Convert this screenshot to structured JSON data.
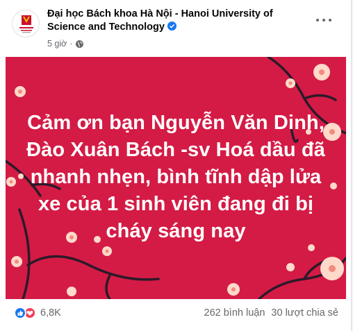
{
  "post": {
    "page_name": "Đại học Bách khoa Hà Nội - Hanoi University of Science and Technology",
    "timestamp": "5 giờ",
    "audience_icon": "globe-icon",
    "verified_icon": "verified-badge-icon",
    "menu_icon": "more-horizontal-icon",
    "image_text": "Cảm ơn bạn Nguyễn Văn Dinh, Đào Xuân Bách -sv Hoá dầu đã nhanh nhẹn, bình tĩnh dập lửa xe của 1 sinh viên đang đi bị cháy sáng nay",
    "reaction_count": "6,8K",
    "comments_count": "262 bình luận",
    "shares_count": "30 lượt chia sẻ"
  },
  "colors": {
    "image_background": "#d41b45",
    "brand_blue": "#1877f2",
    "love_red": "#f33e58",
    "muted_text": "#65676b"
  }
}
